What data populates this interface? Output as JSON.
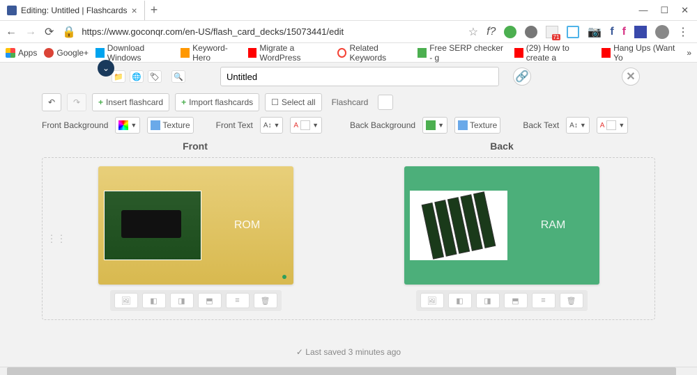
{
  "browser": {
    "tab_title": "Editing: Untitled | Flashcards",
    "url": "https://www.goconqr.com/en-US/flash_card_decks/15073441/edit",
    "new_tab": "+",
    "close_tab": "×",
    "ext_badge": "71",
    "bookmarks": {
      "apps": "Apps",
      "googleplus": "Google+",
      "download": "Download Windows",
      "keyword": "Keyword-Hero",
      "migrate": "Migrate a WordPress",
      "related": "Related Keywords",
      "serp": "Free SERP checker - g",
      "howto": "(29) How to create a",
      "hangups": "Hang Ups (Want Yo",
      "overflow": "»"
    }
  },
  "editor": {
    "title_value": "Untitled",
    "insert": "Insert flashcard",
    "import": "Import flashcards",
    "select_all": "Select all",
    "flashcard_label": "Flashcard",
    "front_bg": "Front Background",
    "texture1": "Texture",
    "front_text": "Front Text",
    "back_bg": "Back Background",
    "texture2": "Texture",
    "back_text": "Back Text"
  },
  "cards": {
    "front_head": "Front",
    "back_head": "Back",
    "front_text": "ROM",
    "back_text": "RAM"
  },
  "status": {
    "text": "✓ Last saved 3 minutes ago"
  },
  "colors": {
    "front_card": "#e0c65f",
    "back_card": "#4caf7a",
    "green_swatch": "#4caf50",
    "red_swatch": "#e53935"
  }
}
